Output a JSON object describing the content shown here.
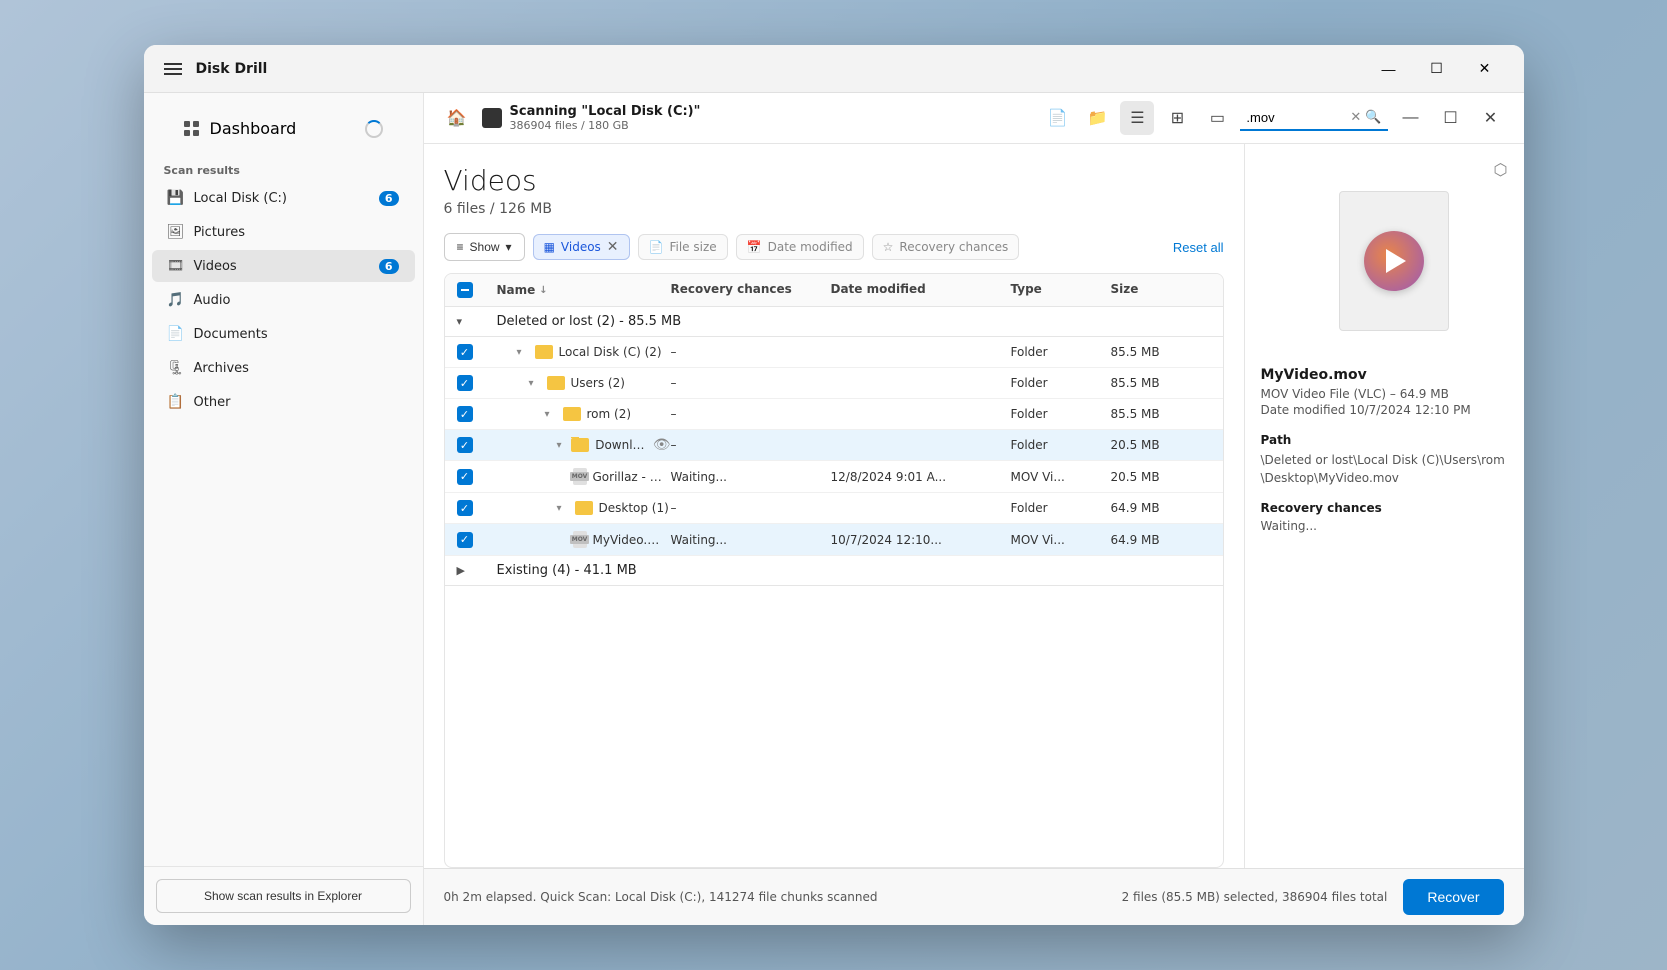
{
  "app": {
    "title": "Disk Drill",
    "window_controls": {
      "minimize": "—",
      "maximize": "☐",
      "close": "✕"
    }
  },
  "toolbar": {
    "scan_title": "Scanning \"Local Disk (C:)\"",
    "scan_subtitle": "386904 files / 180 GB",
    "search_value": ".mov",
    "search_placeholder": ".mov"
  },
  "sidebar": {
    "dashboard_label": "Dashboard",
    "scan_results_label": "Scan results",
    "items": [
      {
        "label": "Local Disk (C:)",
        "badge": "6",
        "icon": "hdd"
      },
      {
        "label": "Pictures",
        "badge": "",
        "icon": "pictures"
      },
      {
        "label": "Videos",
        "badge": "6",
        "icon": "video",
        "active": true
      },
      {
        "label": "Audio",
        "badge": "",
        "icon": "audio"
      },
      {
        "label": "Documents",
        "badge": "",
        "icon": "documents"
      },
      {
        "label": "Archives",
        "badge": "",
        "icon": "archives"
      },
      {
        "label": "Other",
        "badge": "",
        "icon": "other"
      }
    ],
    "show_scan_btn": "Show scan results in Explorer"
  },
  "page": {
    "title": "Videos",
    "subtitle": "6 files / 126 MB"
  },
  "filters": {
    "show_label": "Show",
    "active_filter": "Videos",
    "file_size": "File size",
    "date_modified": "Date modified",
    "recovery_chances": "Recovery chances",
    "reset_all": "Reset all"
  },
  "table": {
    "columns": {
      "name": "Name",
      "recovery_chances": "Recovery chances",
      "date_modified": "Date modified",
      "type": "Type",
      "size": "Size"
    },
    "section_deleted": "Deleted or lost (2) - 85.5 MB",
    "section_existing": "Existing (4) - 41.1 MB",
    "rows": [
      {
        "indent": 1,
        "type": "folder",
        "name": "Local Disk (C) (2)",
        "recovery_chances": "–",
        "date_modified": "",
        "file_type": "Folder",
        "size": "85.5 MB",
        "checked": true,
        "expanded": true
      },
      {
        "indent": 2,
        "type": "folder",
        "name": "Users (2)",
        "recovery_chances": "–",
        "date_modified": "",
        "file_type": "Folder",
        "size": "85.5 MB",
        "checked": true,
        "expanded": true
      },
      {
        "indent": 3,
        "type": "folder",
        "name": "rom (2)",
        "recovery_chances": "–",
        "date_modified": "",
        "file_type": "Folder",
        "size": "85.5 MB",
        "checked": true,
        "expanded": true
      },
      {
        "indent": 4,
        "type": "folder",
        "name": "Download...",
        "recovery_chances": "–",
        "date_modified": "",
        "file_type": "Folder",
        "size": "20.5 MB",
        "checked": true,
        "expanded": true,
        "has_eye": true,
        "highlighted": true
      },
      {
        "indent": 5,
        "type": "file",
        "name": "Gorillaz - On...",
        "recovery_chances": "Waiting...",
        "date_modified": "12/8/2024 9:01 A...",
        "file_type": "MOV Vi...",
        "size": "20.5 MB",
        "checked": true
      },
      {
        "indent": 4,
        "type": "folder",
        "name": "Desktop (1)",
        "recovery_chances": "–",
        "date_modified": "",
        "file_type": "Folder",
        "size": "64.9 MB",
        "checked": true,
        "expanded": true
      },
      {
        "indent": 5,
        "type": "file",
        "name": "MyVideo.mov",
        "recovery_chances": "Waiting...",
        "date_modified": "10/7/2024 12:10...",
        "file_type": "MOV Vi...",
        "size": "64.9 MB",
        "checked": true,
        "selected": true
      }
    ]
  },
  "detail": {
    "filename": "MyVideo.mov",
    "meta1": "MOV Video File (VLC) – 64.9 MB",
    "meta2": "Date modified 10/7/2024 12:10 PM",
    "path_label": "Path",
    "path_value": "\\Deleted or lost\\Local Disk (C)\\Users\\rom\\Desktop\\MyVideo.mov",
    "recovery_label": "Recovery chances",
    "recovery_value": "Waiting..."
  },
  "status_bar": {
    "scan_info": "0h 2m elapsed. Quick Scan: Local Disk (C:), 141274 file chunks scanned",
    "selection_info": "2 files (85.5 MB) selected, 386904 files total",
    "recover_btn": "Recover"
  }
}
